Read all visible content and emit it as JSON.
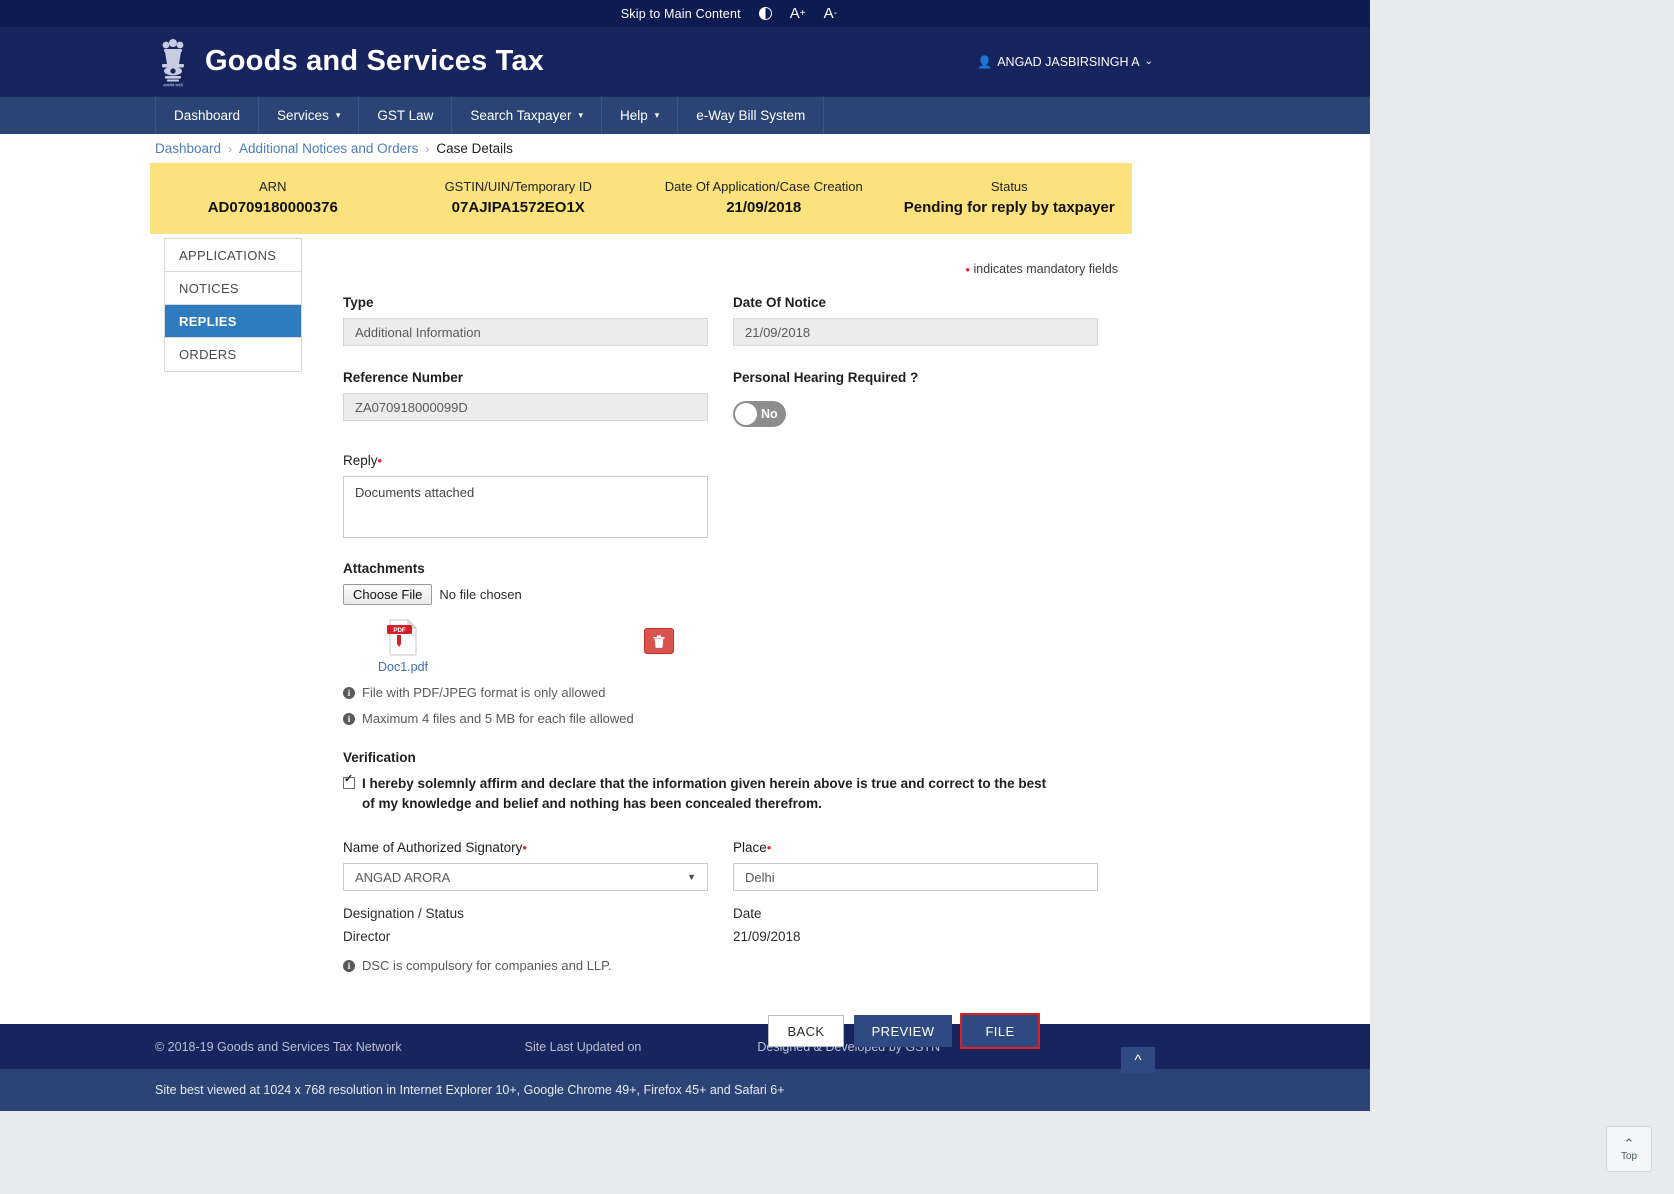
{
  "utility": {
    "skip_label": "Skip to Main Content",
    "contrast_icon": "contrast-toggle-icon",
    "font_increase": "A",
    "font_increase_sup": "+",
    "font_decrease": "A",
    "font_decrease_sup": "-"
  },
  "header": {
    "emblem_icon": "india-national-emblem-icon",
    "title": "Goods and Services Tax",
    "user_icon": "user-icon",
    "user_name": "ANGAD JASBIRSINGH A",
    "user_caret": "⌄"
  },
  "nav": {
    "items": [
      {
        "label": "Dashboard",
        "caret": ""
      },
      {
        "label": "Services",
        "caret": "▾"
      },
      {
        "label": "GST Law",
        "caret": ""
      },
      {
        "label": "Search Taxpayer",
        "caret": "▾"
      },
      {
        "label": "Help",
        "caret": "▾"
      },
      {
        "label": "e-Way Bill System",
        "caret": ""
      }
    ]
  },
  "breadcrumb": {
    "items": [
      "Dashboard",
      "Additional Notices and Orders",
      "Case Details"
    ],
    "separator": "›"
  },
  "summary": {
    "cells": [
      {
        "label": "ARN",
        "value": "AD0709180000376"
      },
      {
        "label": "GSTIN/UIN/Temporary ID",
        "value": "07AJIPA1572EO1X"
      },
      {
        "label": "Date Of Application/Case Creation",
        "value": "21/09/2018"
      },
      {
        "label": "Status",
        "value": "Pending for reply by taxpayer"
      }
    ]
  },
  "side_tabs": [
    {
      "label": "APPLICATIONS",
      "active": false
    },
    {
      "label": "NOTICES",
      "active": false
    },
    {
      "label": "REPLIES",
      "active": true
    },
    {
      "label": "ORDERS",
      "active": false
    }
  ],
  "form": {
    "mandatory_note": "indicates mandatory fields",
    "type_label": "Type",
    "type_value": "Additional Information",
    "date_of_notice_label": "Date Of Notice",
    "date_of_notice_value": "21/09/2018",
    "reference_number_label": "Reference Number",
    "reference_number_value": "ZA070918000099D",
    "personal_hearing_label": "Personal Hearing Required ?",
    "personal_hearing_value": "No",
    "reply_label": "Reply",
    "reply_value": "Documents attached",
    "attachments_label": "Attachments",
    "choose_file_label": "Choose File",
    "no_file_label": "No file chosen",
    "attached_file_name": "Doc1.pdf",
    "attached_file_icon": "pdf-file-icon",
    "delete_icon": "trash-icon",
    "note_1": "File with PDF/JPEG format is only allowed",
    "note_2": "Maximum 4 files and 5 MB for each file allowed",
    "verification_label": "Verification",
    "declaration": "I hereby solemnly affirm and declare that the information given herein above is true and correct to the best of my knowledge and belief and nothing has been concealed therefrom.",
    "signatory_label": "Name of Authorized Signatory",
    "signatory_value": "ANGAD ARORA",
    "place_label": "Place",
    "place_value": "Delhi",
    "designation_label": "Designation / Status",
    "designation_value": "Director",
    "date_label": "Date",
    "date_value": "21/09/2018",
    "dsc_note": "DSC is compulsory for companies and LLP."
  },
  "buttons": {
    "back": "BACK",
    "preview": "PREVIEW",
    "file": "FILE"
  },
  "footer": {
    "copyright": "© 2018-19 Goods and Services Tax Network",
    "last_updated": "Site Last Updated on",
    "designed_by": "Designed & Developed by GSTN",
    "best_viewed": "Site best viewed at 1024 x 768 resolution in Internet Explorer 10+, Google Chrome 49+, Firefox 45+ and Safari 6+"
  },
  "top_widget": {
    "chevron": "⌃",
    "label": "Top"
  },
  "colors": {
    "brand_navy": "#17245e",
    "nav_blue": "#2b4375",
    "accent_blue": "#2e7cbd",
    "summary_yellow": "#fbe27c",
    "danger_red": "#d9534f",
    "mandatory_red": "#e8262c"
  }
}
